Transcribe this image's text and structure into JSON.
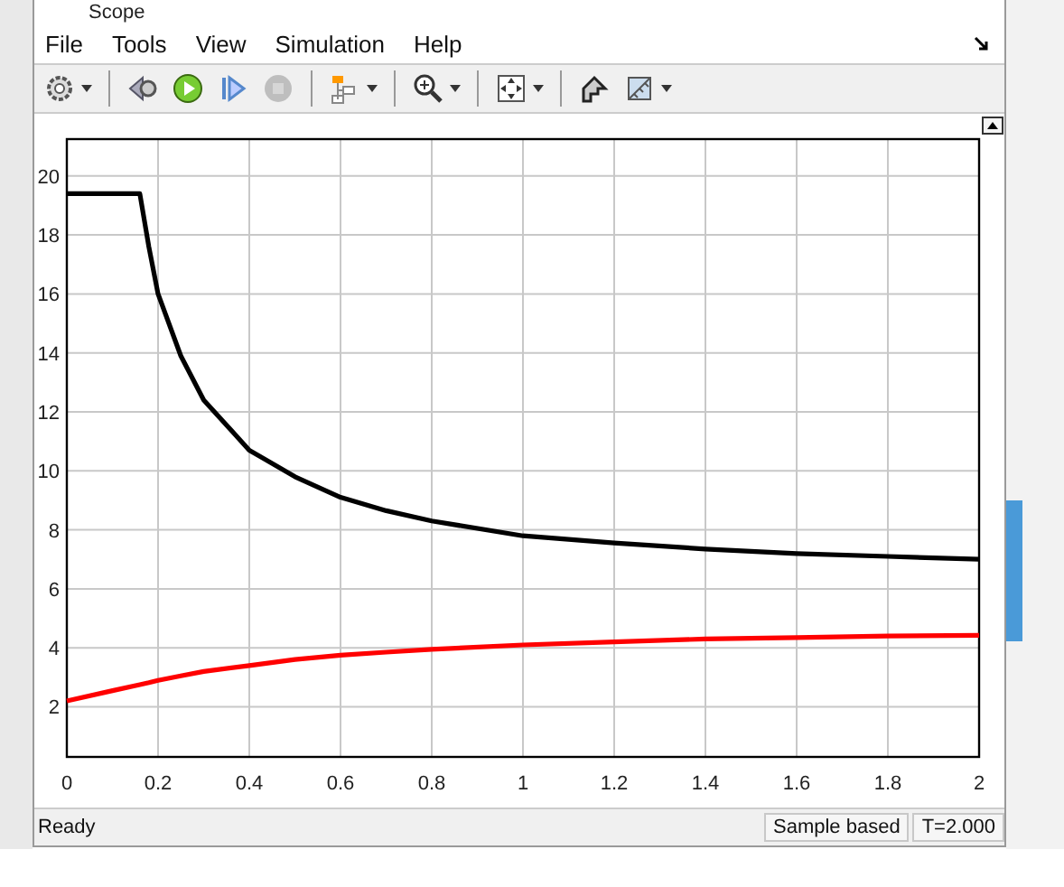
{
  "window": {
    "title": "Scope"
  },
  "menu": [
    {
      "label": "File"
    },
    {
      "label": "Tools"
    },
    {
      "label": "View"
    },
    {
      "label": "Simulation"
    },
    {
      "label": "Help"
    }
  ],
  "toolbar": [
    {
      "kind": "gear",
      "menu": true,
      "disabled": false
    },
    {
      "kind": "sep"
    },
    {
      "kind": "rewind",
      "menu": false,
      "disabled": false
    },
    {
      "kind": "play",
      "menu": false,
      "disabled": false
    },
    {
      "kind": "step",
      "menu": false,
      "disabled": false
    },
    {
      "kind": "stop",
      "menu": false,
      "disabled": true
    },
    {
      "kind": "sep"
    },
    {
      "kind": "signals",
      "menu": true,
      "disabled": false
    },
    {
      "kind": "sep"
    },
    {
      "kind": "zoom",
      "menu": true,
      "disabled": false
    },
    {
      "kind": "sep"
    },
    {
      "kind": "fit",
      "menu": true,
      "disabled": false
    },
    {
      "kind": "sep"
    },
    {
      "kind": "highlight",
      "menu": false,
      "disabled": false
    },
    {
      "kind": "ruler",
      "menu": true,
      "disabled": false
    }
  ],
  "plot": {
    "chart_data": {
      "type": "line",
      "grid": true,
      "x": [
        0,
        0.1,
        0.16,
        0.18,
        0.2,
        0.25,
        0.3,
        0.4,
        0.5,
        0.6,
        0.7,
        0.8,
        1.0,
        1.2,
        1.4,
        1.6,
        1.8,
        2.0
      ],
      "series": [
        {
          "color": "#000000",
          "values": [
            19.4,
            19.4,
            19.4,
            17.6,
            16.0,
            13.9,
            12.4,
            10.7,
            9.8,
            9.1,
            8.65,
            8.3,
            7.8,
            7.55,
            7.35,
            7.2,
            7.1,
            7.0
          ]
        },
        {
          "color": "#ff0000",
          "values": [
            2.2,
            2.55,
            2.75,
            2.82,
            2.9,
            3.05,
            3.2,
            3.4,
            3.6,
            3.75,
            3.85,
            3.95,
            4.1,
            4.2,
            4.3,
            4.35,
            4.4,
            4.42
          ]
        }
      ],
      "xlim": [
        0,
        2
      ],
      "ylim": [
        0.3,
        21.25
      ],
      "xticks": [
        0,
        0.2,
        0.4,
        0.6,
        0.8,
        1,
        1.2,
        1.4,
        1.6,
        1.8,
        2
      ],
      "yticks": [
        2,
        4,
        6,
        8,
        10,
        12,
        14,
        16,
        18,
        20
      ]
    }
  },
  "status_bar": {
    "text": "Ready",
    "mode": "Sample based",
    "time": "T=2.000"
  }
}
